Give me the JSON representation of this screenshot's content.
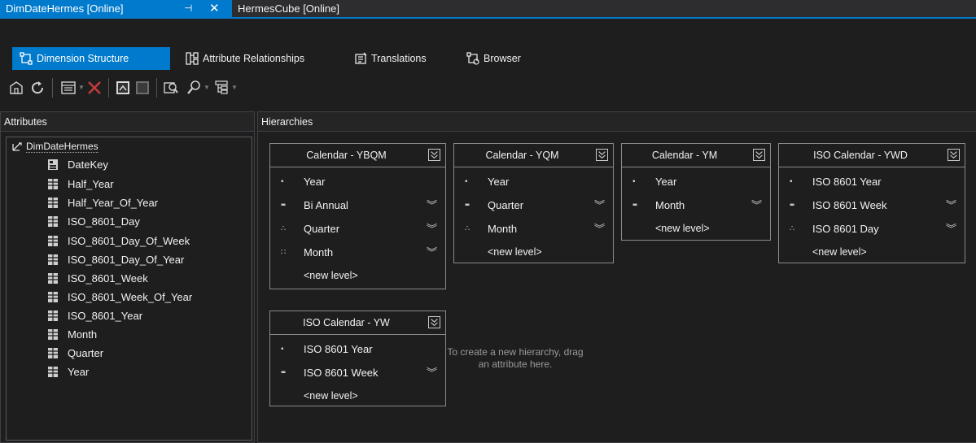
{
  "doc_tabs": {
    "active": "DimDateHermes [Online]",
    "pin_icon": "pin-icon",
    "close_icon": "close-icon",
    "inactive": "HermesCube [Online]"
  },
  "designer_tabs": [
    {
      "label": "Dimension Structure",
      "icon": "dimension-structure-icon"
    },
    {
      "label": "Attribute Relationships",
      "icon": "attribute-relationships-icon"
    },
    {
      "label": "Translations",
      "icon": "translations-icon"
    },
    {
      "label": "Browser",
      "icon": "browser-icon"
    }
  ],
  "toolbar": {
    "icons": [
      "process-icon",
      "refresh-icon",
      "show-table-icon",
      "delete-icon",
      "attribute-grid-icon",
      "hide-table-icon",
      "explore-data-icon",
      "find-icon",
      "tree-view-icon"
    ]
  },
  "attributes": {
    "header": "Attributes",
    "root": "DimDateHermes",
    "items": [
      "DateKey",
      "Half_Year",
      "Half_Year_Of_Year",
      "ISO_8601_Day",
      "ISO_8601_Day_Of_Week",
      "ISO_8601_Day_Of_Year",
      "ISO_8601_Week",
      "ISO_8601_Week_Of_Year",
      "ISO_8601_Year",
      "Month",
      "Quarter",
      "Year"
    ]
  },
  "hierarchies": {
    "header": "Hierarchies",
    "new_level": "<new level>",
    "hint": "To create a new hierarchy, drag an attribute here.",
    "cards": [
      {
        "title": "Calendar - YBQM",
        "levels": [
          {
            "name": "Year",
            "bullet": "▪"
          },
          {
            "name": "Bi Annual",
            "bullet": "▪▪"
          },
          {
            "name": "Quarter",
            "bullet": "∴"
          },
          {
            "name": "Month",
            "bullet": "∷"
          }
        ]
      },
      {
        "title": "Calendar - YQM",
        "levels": [
          {
            "name": "Year",
            "bullet": "▪"
          },
          {
            "name": "Quarter",
            "bullet": "▪▪"
          },
          {
            "name": "Month",
            "bullet": "∴"
          }
        ]
      },
      {
        "title": "Calendar - YM",
        "levels": [
          {
            "name": "Year",
            "bullet": "▪"
          },
          {
            "name": "Month",
            "bullet": "▪▪"
          }
        ]
      },
      {
        "title": "ISO Calendar - YWD",
        "levels": [
          {
            "name": "ISO 8601 Year",
            "bullet": "▪"
          },
          {
            "name": "ISO 8601 Week",
            "bullet": "▪▪"
          },
          {
            "name": "ISO 8601 Day",
            "bullet": "∴"
          }
        ]
      },
      {
        "title": "ISO Calendar - YW",
        "levels": [
          {
            "name": "ISO 8601 Year",
            "bullet": "▪"
          },
          {
            "name": "ISO 8601 Week",
            "bullet": "▪▪"
          }
        ]
      }
    ]
  },
  "colors": {
    "accent": "#007acc",
    "background": "#1e1e1e",
    "panel_header": "#252526"
  }
}
